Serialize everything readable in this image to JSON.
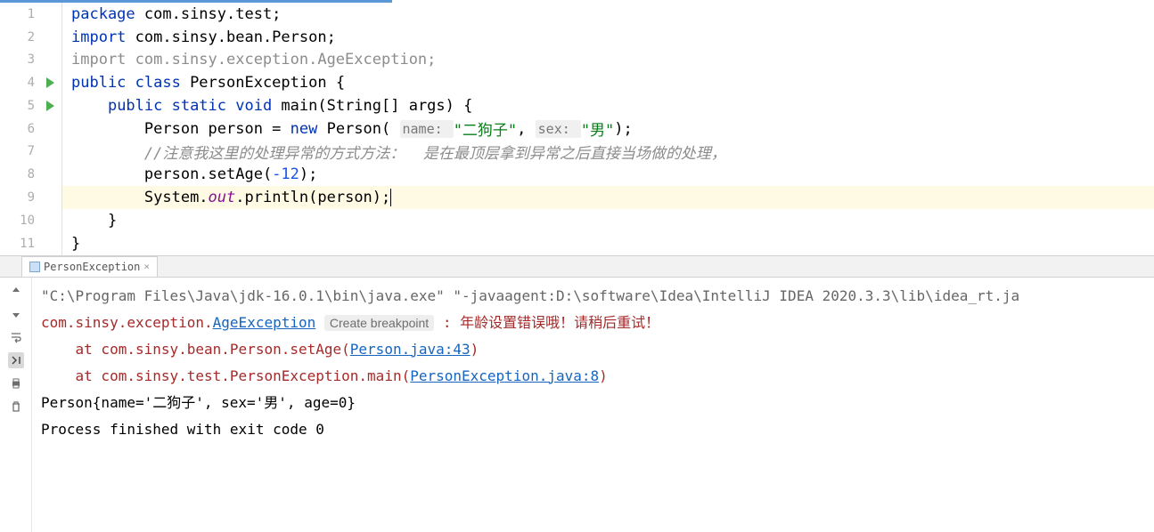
{
  "editor": {
    "lines": [
      {
        "n": "1",
        "tokens": [
          {
            "t": "package ",
            "c": "kw"
          },
          {
            "t": "com.sinsy.test;",
            "c": ""
          }
        ]
      },
      {
        "n": "2",
        "tokens": [
          {
            "t": "import ",
            "c": "kw"
          },
          {
            "t": "com.sinsy.bean.Person;",
            "c": ""
          }
        ]
      },
      {
        "n": "3",
        "tokens": [
          {
            "t": "import com.sinsy.exception.AgeException;",
            "c": "unused"
          }
        ]
      },
      {
        "n": "4",
        "run": true,
        "tokens": [
          {
            "t": "public class ",
            "c": "kw"
          },
          {
            "t": "PersonException {",
            "c": ""
          }
        ]
      },
      {
        "n": "5",
        "run": true,
        "indent": "    ",
        "tokens": [
          {
            "t": "public static void ",
            "c": "kw"
          },
          {
            "t": "main(String[] args) {",
            "c": ""
          }
        ]
      },
      {
        "n": "6",
        "indent": "        ",
        "tokens": [
          {
            "t": "Person person = ",
            "c": ""
          },
          {
            "t": "new ",
            "c": "kw"
          },
          {
            "t": "Person( ",
            "c": ""
          },
          {
            "t": "name: ",
            "c": "hint"
          },
          {
            "t": "\"二狗子\"",
            "c": "str"
          },
          {
            "t": ", ",
            "c": ""
          },
          {
            "t": "sex: ",
            "c": "hint"
          },
          {
            "t": "\"男\"",
            "c": "str"
          },
          {
            "t": ");",
            "c": ""
          }
        ]
      },
      {
        "n": "7",
        "indent": "        ",
        "tokens": [
          {
            "t": "//注意我这里的处理异常的方式方法：  是在最顶层拿到异常之后直接当场做的处理，",
            "c": "com"
          }
        ]
      },
      {
        "n": "8",
        "indent": "        ",
        "tokens": [
          {
            "t": "person.setAge(",
            "c": ""
          },
          {
            "t": "-12",
            "c": "num"
          },
          {
            "t": ");",
            "c": ""
          }
        ]
      },
      {
        "n": "9",
        "active": true,
        "indent": "        ",
        "tokens": [
          {
            "t": "System.",
            "c": ""
          },
          {
            "t": "out",
            "c": "field"
          },
          {
            "t": ".println(person);",
            "c": ""
          }
        ],
        "cursor": true
      },
      {
        "n": "10",
        "indent": "    ",
        "tokens": [
          {
            "t": "}",
            "c": ""
          }
        ]
      },
      {
        "n": "11",
        "tokens": [
          {
            "t": "}",
            "c": ""
          }
        ]
      }
    ]
  },
  "console": {
    "tab": {
      "label": "PersonException",
      "close": "×"
    },
    "lines": [
      {
        "parts": [
          {
            "t": "\"C:\\Program Files\\Java\\jdk-16.0.1\\bin\\java.exe\" \"-javaagent:D:\\software\\Idea\\IntelliJ IDEA 2020.3.3\\lib\\idea_rt.ja",
            "c": "cmd"
          }
        ]
      },
      {
        "parts": [
          {
            "t": "com.sinsy.exception.",
            "c": "err"
          },
          {
            "t": "AgeException",
            "c": "err link"
          },
          {
            "t": " ",
            "c": ""
          },
          {
            "t": "Create breakpoint",
            "c": "bp-btn"
          },
          {
            "t": " : 年龄设置错误哦！请稍后重试！",
            "c": "err"
          }
        ]
      },
      {
        "parts": [
          {
            "t": "    at com.sinsy.bean.Person.setAge(",
            "c": "err"
          },
          {
            "t": "Person.java:43",
            "c": "link"
          },
          {
            "t": ")",
            "c": "err"
          }
        ]
      },
      {
        "parts": [
          {
            "t": "    at com.sinsy.test.PersonException.main(",
            "c": "err"
          },
          {
            "t": "PersonException.java:8",
            "c": "link"
          },
          {
            "t": ")",
            "c": "err"
          }
        ]
      },
      {
        "parts": [
          {
            "t": "Person{name='二狗子', sex='男', age=0}",
            "c": ""
          }
        ]
      },
      {
        "parts": [
          {
            "t": "",
            "c": ""
          }
        ]
      },
      {
        "parts": [
          {
            "t": "Process finished with exit code 0",
            "c": ""
          }
        ]
      }
    ]
  }
}
